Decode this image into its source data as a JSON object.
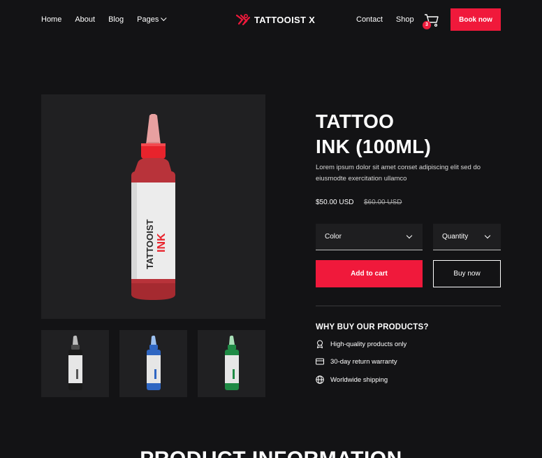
{
  "nav": {
    "left_items": [
      {
        "label": "Home"
      },
      {
        "label": "About"
      },
      {
        "label": "Blog"
      },
      {
        "label": "Pages"
      }
    ],
    "brand": "TATTOOIST X",
    "right_items": [
      {
        "label": "Contact"
      },
      {
        "label": "Shop"
      }
    ],
    "cart_count": "3",
    "book_label": "Book now"
  },
  "gallery": {
    "main_bottle_color": "#b8333a",
    "label_text": "TATTOOIST",
    "label_brand": "INK",
    "thumbs": [
      {
        "color": "#1a1a1a"
      },
      {
        "color": "#2f66c2"
      },
      {
        "color": "#1f8a45"
      }
    ]
  },
  "product": {
    "title_line1": "TATTOO",
    "title_line2": "INK (100ML)",
    "description": "Lorem ipsum dolor sit amet conset adipiscing elit sed do eiusmodte exercitation ullamco",
    "price": "$50.00 USD",
    "old_price": "$60.00 USD",
    "color_select": "Color",
    "quantity_select": "Quantity",
    "add_to_cart": "Add to cart",
    "buy_now": "Buy now"
  },
  "why": {
    "title": "WHY BUY OUR PRODUCTS?",
    "features": [
      {
        "label": "High-quality products only",
        "icon": "award-icon"
      },
      {
        "label": "30-day return warranty",
        "icon": "card-icon"
      },
      {
        "label": "Worldwide shipping",
        "icon": "globe-icon"
      }
    ]
  },
  "section": {
    "title": "PRODUCT INFORMATION"
  },
  "colors": {
    "accent": "#f0193b",
    "background": "#131315",
    "panel": "#202022"
  }
}
